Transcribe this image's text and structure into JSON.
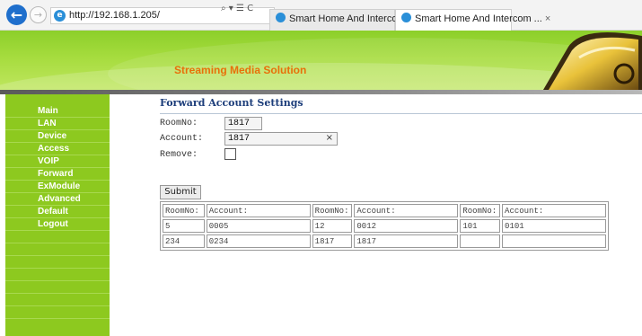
{
  "browser": {
    "address": "http://192.168.1.205/",
    "address_tools": "⌕ ▾ ☰ C",
    "tabs": [
      {
        "label": "Smart Home And Intercom Sys..."
      },
      {
        "label": "Smart Home And Intercom ...",
        "close": "×"
      }
    ]
  },
  "banner": {
    "title": "Streaming Media Solution"
  },
  "sidebar": {
    "items": [
      {
        "label": "Main"
      },
      {
        "label": "LAN"
      },
      {
        "label": "Device"
      },
      {
        "label": "Access"
      },
      {
        "label": "VOIP"
      },
      {
        "label": "Forward"
      },
      {
        "label": "ExModule"
      },
      {
        "label": "Advanced"
      },
      {
        "label": "Default"
      },
      {
        "label": "Logout"
      }
    ]
  },
  "page": {
    "title": "Forward Account Settings"
  },
  "form": {
    "room_label": "RoomNo:",
    "room_value": "1817",
    "account_label": "Account:",
    "account_value": "1817",
    "account_clear": "×",
    "remove_label": "Remove:",
    "remove_checked": false,
    "submit_label": "Submit"
  },
  "table": {
    "rows": [
      [
        "RoomNo:",
        "Account:",
        "RoomNo:",
        "Account:",
        "RoomNo:",
        "Account:"
      ],
      [
        "5",
        "0005",
        "12",
        "0012",
        "101",
        "0101"
      ],
      [
        "234",
        "0234",
        "1817",
        "1817",
        "",
        ""
      ]
    ]
  },
  "colors": {
    "sidebar": "#8dc91f",
    "banner": "#a6dc3e",
    "banner_title": "#e8700a",
    "page_title": "#1c3d7a"
  }
}
